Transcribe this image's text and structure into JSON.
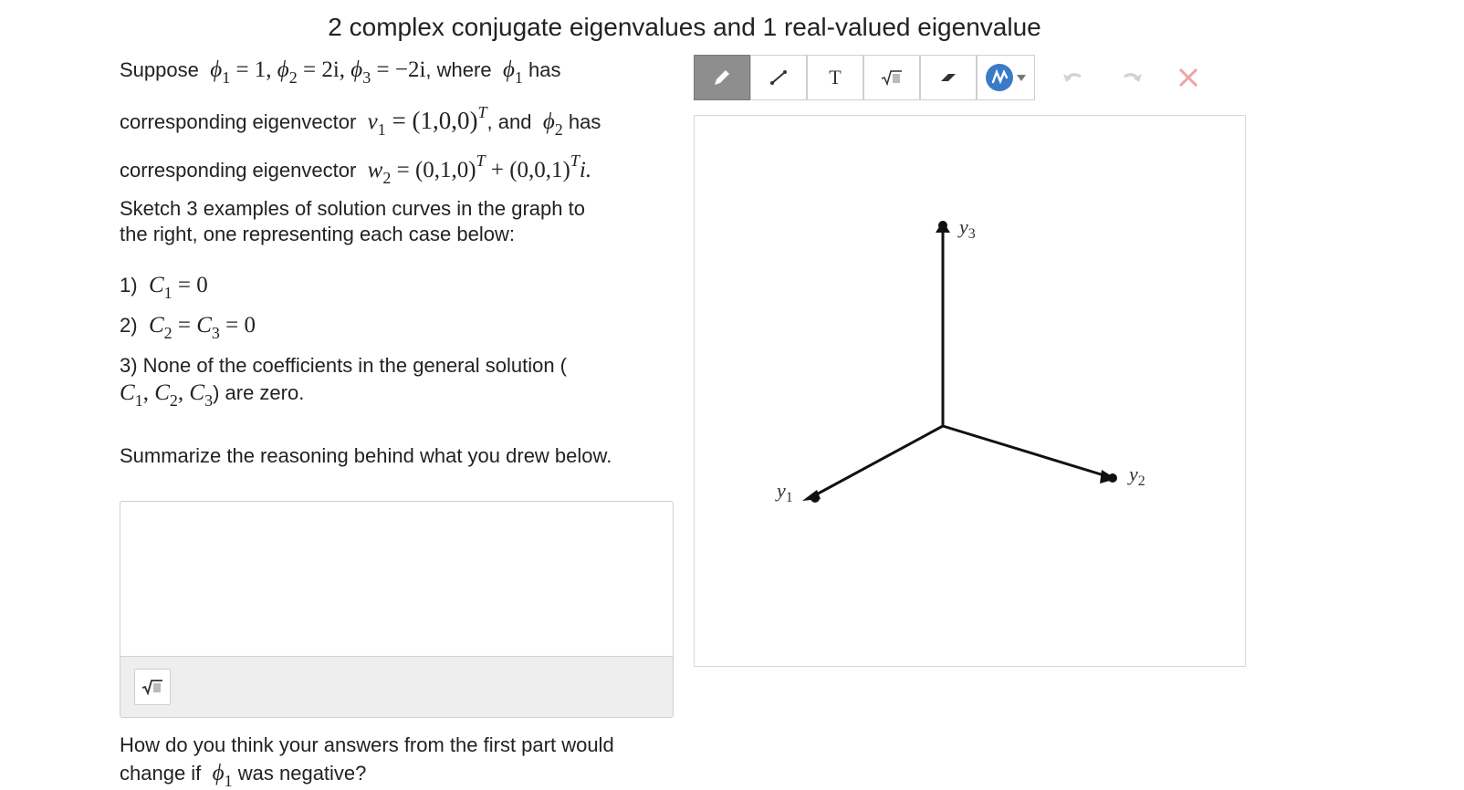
{
  "title": "2 complex conjugate eigenvalues and 1 real-valued eigenvalue",
  "prompt": {
    "suppose": "Suppose",
    "where": ", where",
    "has1": "has",
    "corr1": "corresponding eigenvector",
    "and": ", and",
    "has2": "has",
    "corr2": "corresponding eigenvector",
    "sketch_line1": "Sketch 3 examples of solution curves in the graph to",
    "sketch_line2": "the right, one representing each case below:",
    "case3_text": "3) None of the coefficients in the general solution (",
    "case3_tail": ") are zero.",
    "summarize": "Summarize the reasoning behind what you drew below.",
    "question2_line1": "How do you think your answers from the first part would",
    "question2_pre": "change if",
    "question2_post": "was negative?"
  },
  "math": {
    "phi1_eq": " = 1, ",
    "phi2_eq": " = 2i, ",
    "phi3_eq": " = −2i",
    "v1_eq": " = (1,0,0)",
    "w2_eq": " = (0,1,0)",
    "w2_plus": " + (0,0,1)",
    "w2_tail": "i.",
    "c1_eq": " = 0",
    "c2c3_eq": " = 0",
    "T": "T"
  },
  "cases": {
    "c1_prefix": "1)",
    "c2_prefix": "2)"
  },
  "toolbar": {
    "icons": [
      "pencil-icon",
      "line-icon",
      "text-icon",
      "sqrt-icon",
      "eraser-icon",
      "color-picker-icon",
      "undo-icon",
      "redo-icon",
      "clear-icon"
    ],
    "text_tool_label": "T",
    "accent": "#3a7bc8",
    "clear_color": "#e87e7e"
  },
  "graph": {
    "axes": [
      {
        "name": "y1",
        "label": "y",
        "sub": "1"
      },
      {
        "name": "y2",
        "label": "y",
        "sub": "2"
      },
      {
        "name": "y3",
        "label": "y",
        "sub": "3"
      }
    ]
  }
}
